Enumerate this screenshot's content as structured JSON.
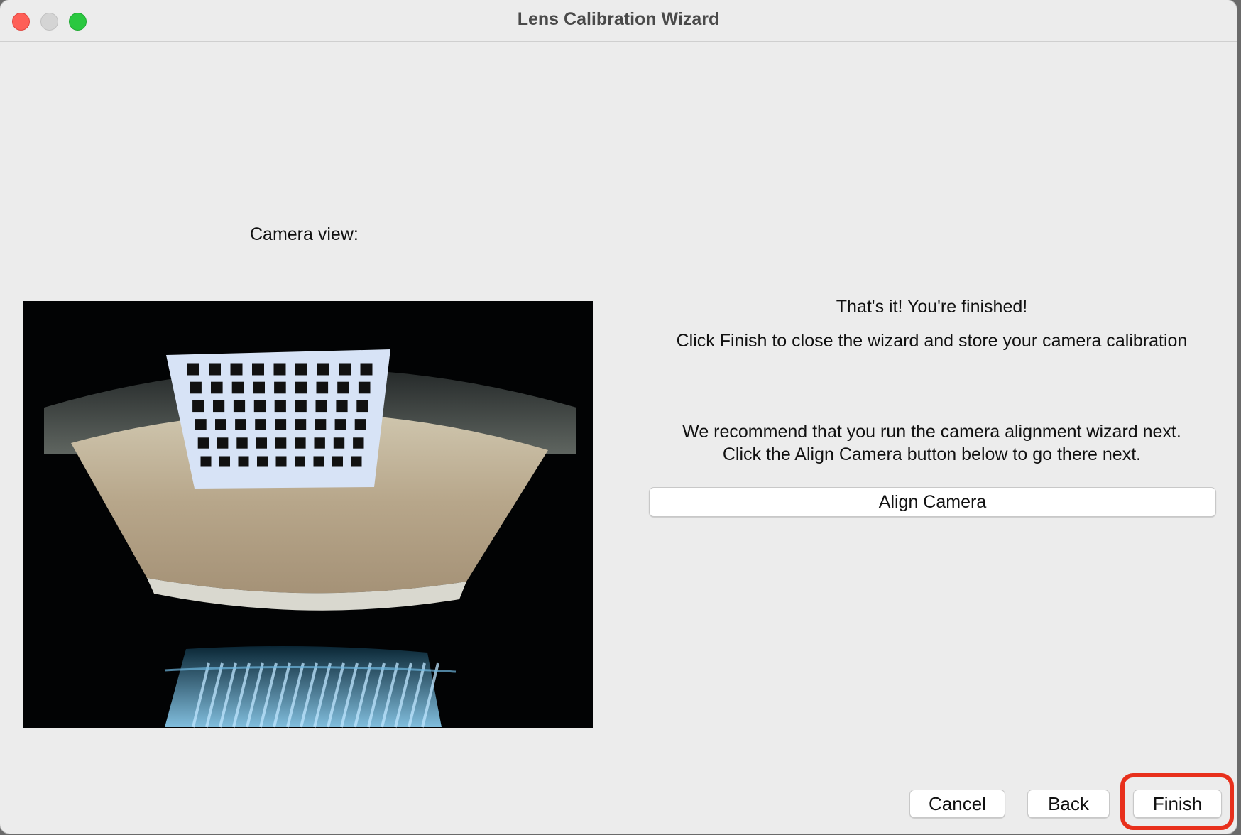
{
  "window": {
    "title": "Lens Calibration Wizard"
  },
  "camera": {
    "label": "Camera view:"
  },
  "message": {
    "heading": "That's it!  You're finished!",
    "instruction": "Click Finish to close the wizard and store your camera calibration",
    "recommend_line1": "We recommend that you run the camera alignment wizard next.",
    "recommend_line2": "Click the Align Camera button below to go there next."
  },
  "buttons": {
    "align_camera": "Align Camera",
    "cancel": "Cancel",
    "back": "Back",
    "finish": "Finish"
  },
  "colors": {
    "window_bg": "#ececec",
    "highlight": "#e8301c"
  }
}
